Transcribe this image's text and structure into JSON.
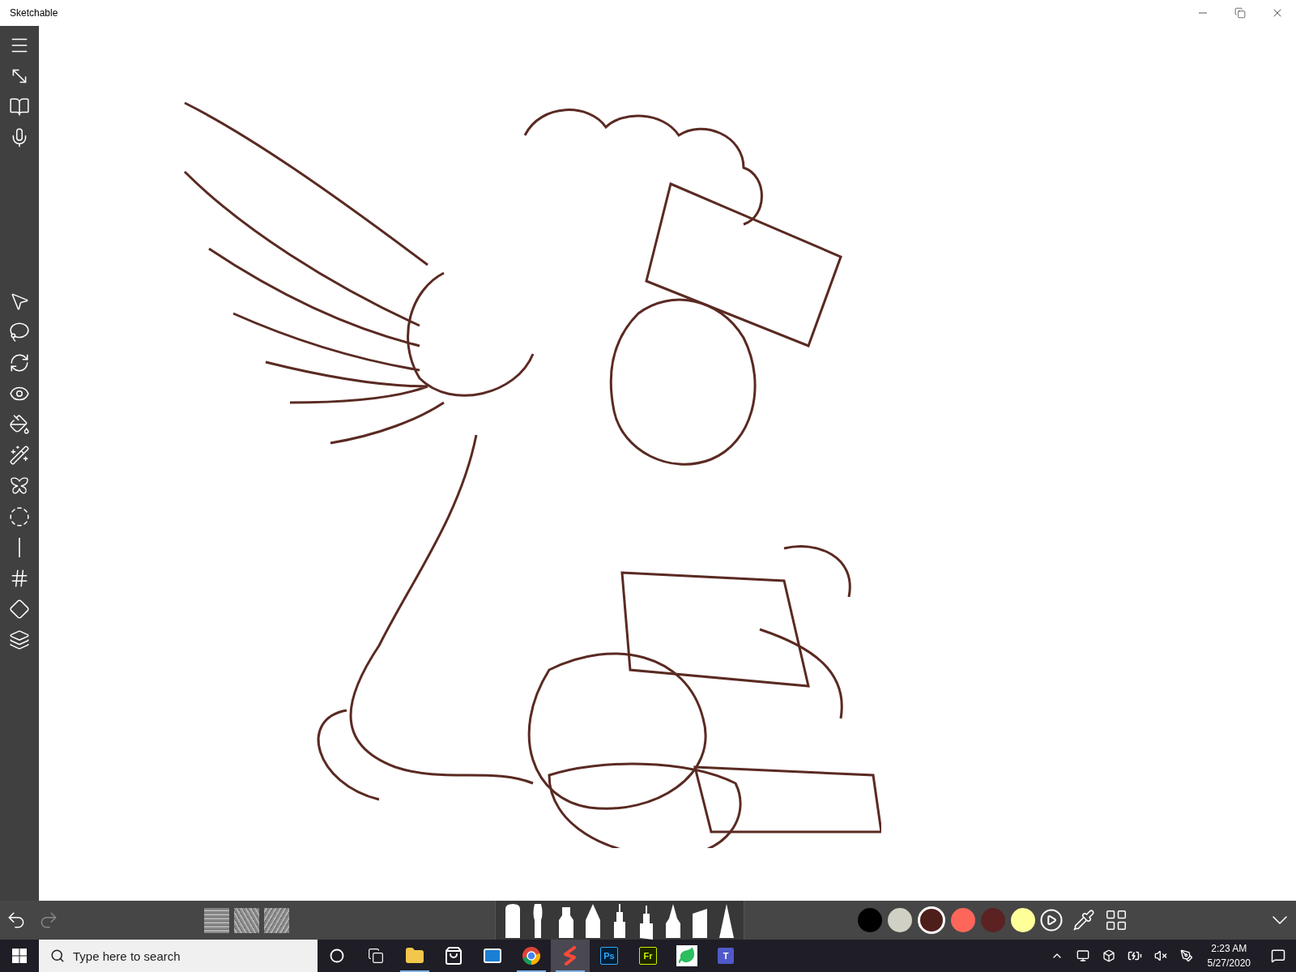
{
  "window": {
    "title": "Sketchable"
  },
  "palette": [
    {
      "color": "#000000",
      "selected": false
    },
    {
      "color": "#d0d0c4",
      "selected": false
    },
    {
      "color": "#4e1e1a",
      "selected": true
    },
    {
      "color": "#ff665a",
      "selected": false
    },
    {
      "color": "#5c2222",
      "selected": false
    },
    {
      "color": "#ffff99",
      "selected": false
    }
  ],
  "taskbar": {
    "search": {
      "placeholder": "Type here to search"
    },
    "apps": [
      {
        "kind": "folder",
        "running": true,
        "selected": false
      },
      {
        "kind": "store",
        "running": false,
        "selected": false
      },
      {
        "kind": "mail",
        "running": false,
        "selected": false
      },
      {
        "kind": "browser",
        "running": true,
        "selected": false
      },
      {
        "kind": "sketch",
        "running": true,
        "selected": true
      },
      {
        "kind": "badge-blue",
        "label": "Ps",
        "running": false,
        "selected": false
      },
      {
        "kind": "badge-green",
        "label": "Fr",
        "running": false,
        "selected": false
      },
      {
        "kind": "note",
        "running": false,
        "selected": false
      },
      {
        "kind": "teams",
        "label": "T",
        "running": false,
        "selected": false
      }
    ],
    "time": "2:23 AM",
    "date": "5/27/2020"
  }
}
